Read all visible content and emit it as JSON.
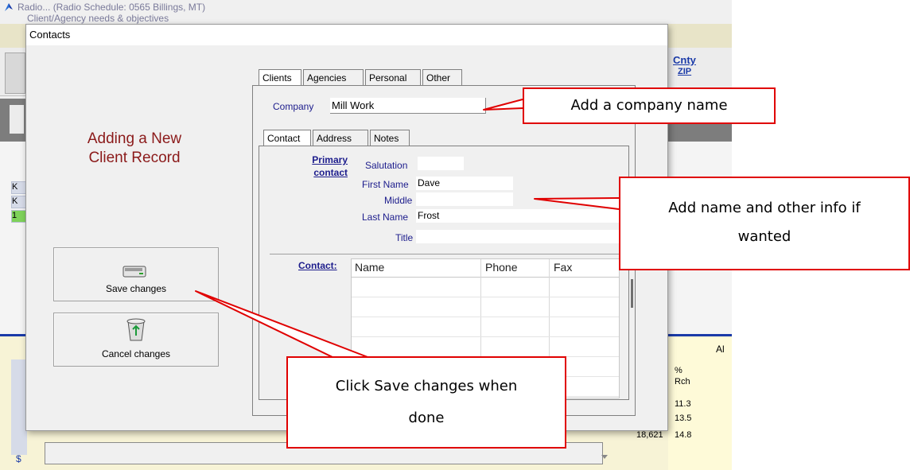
{
  "background": {
    "window_title": "Radio... (Radio Schedule: 0565 Billings, MT)",
    "subtitle": "Client/Agency needs & objectives",
    "cnty_label": "Cnty",
    "zip_label": "ZIP",
    "al_label": "Al",
    "pct_header": "%",
    "rch_header": "Rch",
    "pct_values": [
      "11.3",
      "13.5",
      "14.8"
    ],
    "count_value": "18,621",
    "left_cells": [
      "K",
      "K",
      "1"
    ],
    "dollar": "$"
  },
  "dialog": {
    "title": "Contacts",
    "heading_line1": "Adding a New",
    "heading_line2": "Client Record",
    "save_button": "Save changes",
    "cancel_button": "Cancel changes",
    "tabs": [
      "Clients",
      "Agencies",
      "Personal",
      "Other"
    ],
    "company_label": "Company",
    "company_value": "Mill Work",
    "subtabs": [
      "Contact",
      "Address",
      "Notes"
    ],
    "primary_contact_line1": "Primary",
    "primary_contact_line2": "contact",
    "salutation_label": "Salutation",
    "salutation_value": "",
    "first_name_label": "First Name",
    "first_name_value": "Dave",
    "middle_label": "Middle",
    "middle_value": "",
    "last_name_label": "Last Name",
    "last_name_value": "Frost",
    "title_label": "Title",
    "title_value": "",
    "contact_link": "Contact:",
    "grid_columns": [
      "Name",
      "Phone",
      "Fax"
    ]
  },
  "callouts": {
    "company": "Add a company name",
    "name": "Add name and other info if wanted",
    "save": "Click Save changes when done"
  },
  "colors": {
    "heading": "#8b1a1a",
    "label": "#1c1c8c",
    "callout_border": "#e00000",
    "accent_blue": "#1a3aa8"
  }
}
